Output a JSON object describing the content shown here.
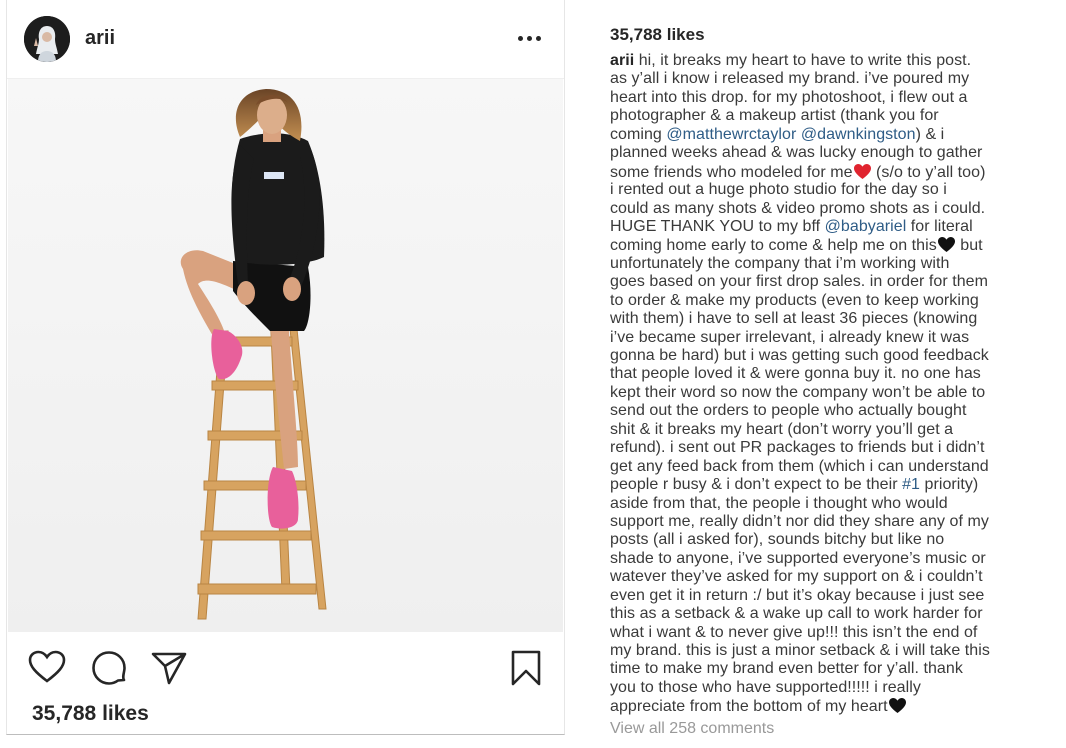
{
  "post": {
    "username": "arii",
    "likes": "35,788 likes"
  },
  "icons": {
    "more": "more-options-icon",
    "like": "heart-outline-icon",
    "comment": "comment-icon",
    "share": "share-icon",
    "save": "bookmark-icon",
    "emoji_red_heart": "red-heart-emoji",
    "emoji_black_heart": "black-heart-emoji"
  },
  "colors": {
    "text": "#262626",
    "mention": "#2e5c86",
    "muted": "#999999",
    "red_heart": "#e0242f",
    "black_heart": "#111111"
  },
  "caption": {
    "author": "arii",
    "line_0": " hi, it breaks my heart to have to write this post.",
    "line_1": "as y’all i know i released my brand. i’ve poured my",
    "line_2": "heart into this drop. for my photoshoot, i flew out a",
    "line_3": "photographer & a makeup artist (thank you for",
    "line_4a": "coming ",
    "mention_1": "@matthewrctaylor",
    "line_4b": " ",
    "mention_2": "@dawnkingston",
    "line_4c": ") & i",
    "line_5": "planned weeks ahead & was lucky enough to gather",
    "line_6a": "some friends who modeled for me",
    "line_6b": " (s/o to y’all too)",
    "line_7": "i rented out a huge photo studio for the day so i",
    "line_8": "could as many shots & video promo shots as i could.",
    "line_9a": "HUGE THANK YOU to my bff ",
    "mention_3": "@babyariel",
    "line_9b": " for literal",
    "line_10a": "coming home early to come & help me on this",
    "line_10b": " but",
    "line_11": "unfortunately the company that i’m working with",
    "line_12": "goes based on your first drop sales. in order for them",
    "line_13": "to order & make my products (even to keep working",
    "line_14": "with them) i have to sell at least 36 pieces (knowing",
    "line_15": "i’ve became super irrelevant, i already knew it was",
    "line_16": "gonna be hard) but i was getting such good feedback",
    "line_17": "that people loved it & were gonna buy it. no one has",
    "line_18": "kept their word so now the company won’t be able to",
    "line_19": "send out the orders to people who actually bought",
    "line_20": "shit & it breaks my heart (don’t worry you’ll get a",
    "line_21": "refund). i sent out PR packages to friends but i didn’t",
    "line_22": "get any feed back from them (which i can understand",
    "line_23a": "people r busy & i don’t expect to be their ",
    "hashtag": "#1",
    "line_23b": " priority)",
    "line_24": "aside from that, the people i thought who would",
    "line_25": "support me, really didn’t nor did they share any of my",
    "line_26": "posts (all i asked for), sounds bitchy but like no",
    "line_27": "shade to anyone, i’ve supported everyone’s music or",
    "line_28": "watever they’ve asked for my support on & i couldn’t",
    "line_29": "even get it in return :/ but it’s okay because i just see",
    "line_30": "this as a setback & a wake up call to work harder for",
    "line_31": "what i want & to never give up!!! this isn’t the end of",
    "line_32": "my brand. this is just a minor setback & i will take this",
    "line_33": "time to make my brand even better for y’all. thank",
    "line_34": "you to those who have supported!!!!! i really",
    "line_35": "appreciate from the bottom of my heart"
  },
  "comments_link": "View all 258 comments"
}
